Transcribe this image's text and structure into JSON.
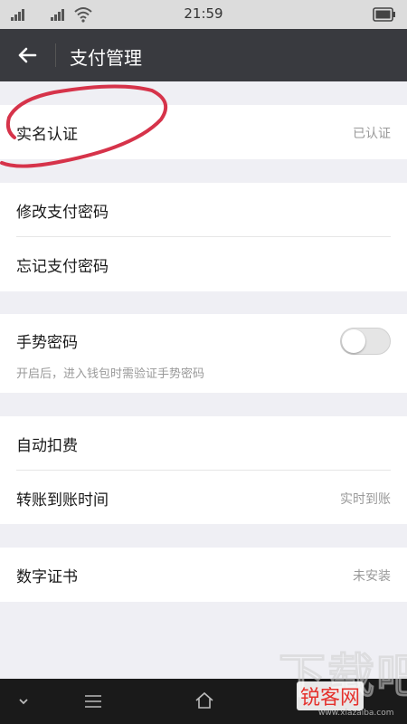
{
  "status_bar": {
    "signal_1_letter": "il",
    "signal_2_letter": "il",
    "time": "21:59"
  },
  "toolbar": {
    "back_icon": "arrow-left",
    "title": "支付管理"
  },
  "groups": [
    {
      "rows": [
        {
          "label": "实名认证",
          "value": "已认证"
        }
      ]
    },
    {
      "rows": [
        {
          "label": "修改支付密码"
        },
        {
          "label": "忘记支付密码"
        }
      ]
    },
    {
      "gesture": {
        "label": "手势密码",
        "description": "开启后，进入钱包时需验证手势密码",
        "enabled": false
      }
    },
    {
      "rows": [
        {
          "label": "自动扣费"
        },
        {
          "label": "转账到账时间",
          "value": "实时到账"
        }
      ]
    },
    {
      "rows": [
        {
          "label": "数字证书",
          "value": "未安装"
        }
      ]
    }
  ],
  "watermark": {
    "big_text": "下载吧",
    "brand": "锐客网",
    "url": "www.xiazaiba.com"
  },
  "colors": {
    "toolbar_bg": "#393a3f",
    "page_bg": "#efeff4",
    "annotation": "#d6334a",
    "watermark_red": "#e5322d"
  },
  "icons": [
    "signal-icon",
    "wifi-icon",
    "battery-icon",
    "back-arrow-icon",
    "chevron-down-icon",
    "menu-icon",
    "home-icon"
  ]
}
